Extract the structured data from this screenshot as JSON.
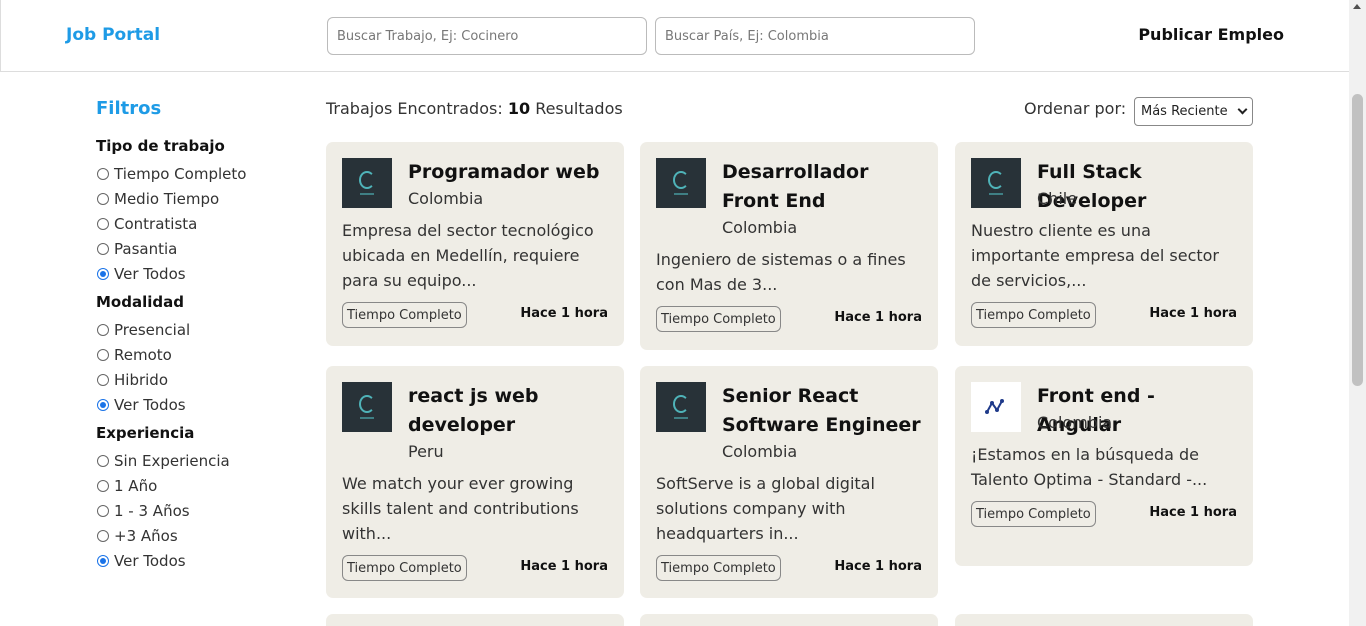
{
  "header": {
    "logo": "Job Portal",
    "search_job_placeholder": "Buscar Trabajo, Ej: Cocinero",
    "search_country_placeholder": "Buscar País, Ej: Colombia",
    "publish_label": "Publicar Empleo"
  },
  "sidebar": {
    "title": "Filtros",
    "groups": [
      {
        "title": "Tipo de trabajo",
        "options": [
          "Tiempo Completo",
          "Medio Tiempo",
          "Contratista",
          "Pasantia",
          "Ver Todos"
        ],
        "selected": 4
      },
      {
        "title": "Modalidad",
        "options": [
          "Presencial",
          "Remoto",
          "Hibrido",
          "Ver Todos"
        ],
        "selected": 3
      },
      {
        "title": "Experiencia",
        "options": [
          "Sin Experiencia",
          "1 Año",
          "1 - 3 Años",
          "+3 Años",
          "Ver Todos"
        ],
        "selected": 4
      }
    ]
  },
  "results": {
    "label": "Trabajos Encontrados:",
    "count": "10",
    "suffix": "Resultados",
    "sort_label": "Ordenar por:",
    "sort_value": "Más Reciente"
  },
  "jobs": [
    {
      "title": "Programador web",
      "country": "Colombia",
      "description": "Empresa del sector tecnológico ubicada en Medellín, requiere para su equipo...",
      "type": "Tiempo Completo",
      "time": "Hace 1 hora",
      "logo": "tera"
    },
    {
      "title": "Desarrollador Front End",
      "country": "Colombia",
      "description": "Ingeniero de sistemas o a fines con Mas de 3...",
      "type": "Tiempo Completo",
      "time": "Hace 1 hora",
      "logo": "tera"
    },
    {
      "title": "Full Stack Developer",
      "country": "Chile",
      "description": "Nuestro cliente es una importante empresa del sector de servicios,...",
      "type": "Tiempo Completo",
      "time": "Hace 1 hora",
      "logo": "tera"
    },
    {
      "title": "react js web developer",
      "country": "Peru",
      "description": "We match your ever growing skills talent and contributions with...",
      "type": "Tiempo Completo",
      "time": "Hace 1 hora",
      "logo": "tera"
    },
    {
      "title": "Senior React Software Engineer",
      "country": "Colombia",
      "description": "SoftServe is a global digital solutions company with headquarters in...",
      "type": "Tiempo Completo",
      "time": "Hace 1 hora",
      "logo": "tera"
    },
    {
      "title": "Front end - Angular",
      "country": "Colombia",
      "description": "¡Estamos en la búsqueda de Talento Optima - Standard -...",
      "type": "Tiempo Completo",
      "time": "Hace 1 hora",
      "logo": "ntech"
    }
  ],
  "colors": {
    "accent": "#1e9be6",
    "card_bg": "#efede6",
    "logo_bg": "#283238"
  },
  "icons": {
    "company_logo": "company-logo-icon",
    "sort": "chevron-down-icon"
  }
}
